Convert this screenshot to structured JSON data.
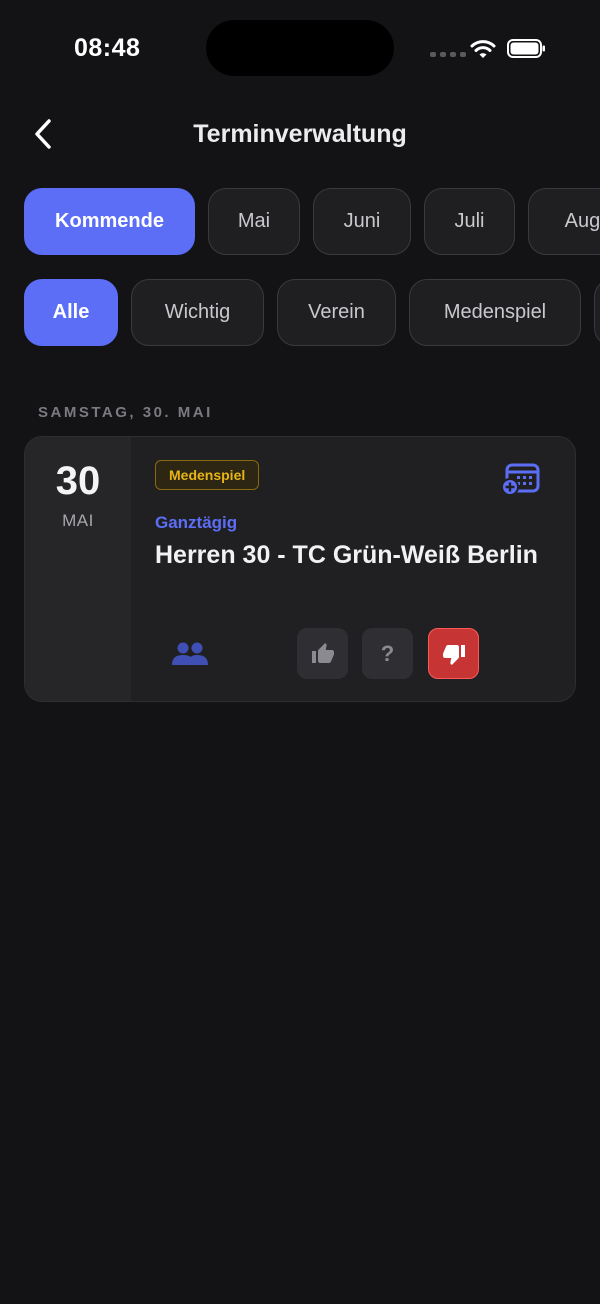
{
  "status_bar": {
    "time": "08:48"
  },
  "header": {
    "title": "Terminverwaltung"
  },
  "month_filters": [
    "Kommende",
    "Mai",
    "Juni",
    "Juli",
    "Augu"
  ],
  "category_filters": [
    "Alle",
    "Wichtig",
    "Verein",
    "Medenspiel"
  ],
  "section": {
    "label": "SAMSTAG, 30. MAI"
  },
  "event": {
    "day": "30",
    "month": "MAI",
    "tag": "Medenspiel",
    "time_label": "Ganztägig",
    "title": "Herren 30 - TC Grün-Weiß Berlin",
    "rsvp_maybe": "?"
  },
  "colors": {
    "accent": "#5b6ef5",
    "tag_text": "#e6b417",
    "decline": "#c73434",
    "background": "#131315"
  },
  "icons": {
    "back": "chevron-left-icon",
    "calendar_add": "calendar-plus-icon",
    "participants": "people-icon",
    "accept": "thumbs-up-icon",
    "decline": "thumbs-down-icon"
  }
}
